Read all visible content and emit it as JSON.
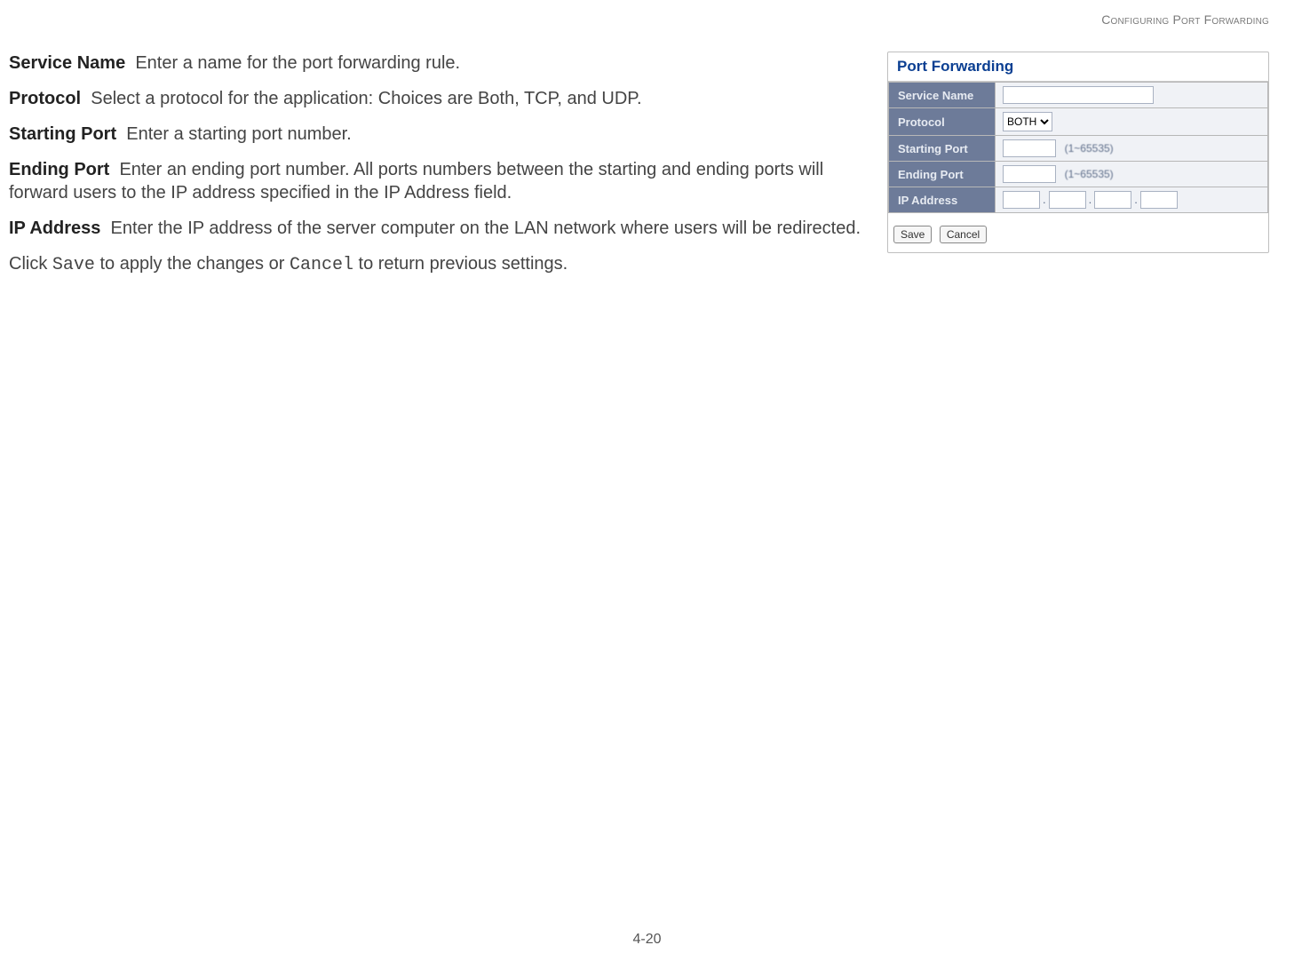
{
  "header": {
    "section_title": "Configuring Port Forwarding"
  },
  "definitions": {
    "service_name": {
      "label": "Service Name",
      "desc": "Enter a name for the port forwarding rule."
    },
    "protocol": {
      "label": "Protocol",
      "desc": "Select a protocol for the application: Choices are Both, TCP, and UDP."
    },
    "start_port": {
      "label": "Starting Port",
      "desc": "Enter a starting port number."
    },
    "end_port": {
      "label": "Ending Port",
      "desc": "Enter an ending port number. All ports numbers between the starting and ending ports will forward users to the IP address specified in the IP Address field."
    },
    "ip_address": {
      "label": "IP Address",
      "desc": "Enter the IP address of the server computer on the LAN network where users will be redirected."
    }
  },
  "closing": {
    "prefix": "Click ",
    "save": "Save",
    "middle": " to apply the changes or ",
    "cancel": "Cancel",
    "suffix": " to return previous settings."
  },
  "screenshot": {
    "title": "Port Forwarding",
    "rows": {
      "service_name": "Service Name",
      "protocol": "Protocol",
      "starting_port": "Starting Port",
      "ending_port": "Ending Port",
      "ip_address": "IP Address"
    },
    "protocol_selected": "BOTH",
    "port_hint": "(1~65535)",
    "dot": ".",
    "buttons": {
      "save": "Save",
      "cancel": "Cancel"
    }
  },
  "footer": {
    "page_number": "4-20"
  }
}
